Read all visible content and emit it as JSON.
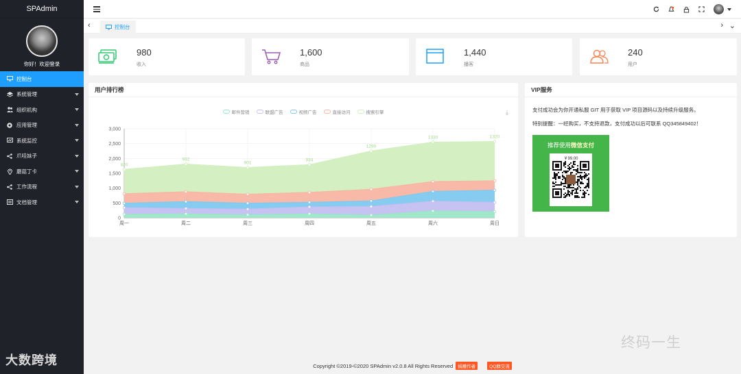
{
  "app": {
    "brand": "SPAdmin",
    "welcome": "你好！欢迎登录"
  },
  "menu": [
    {
      "label": "控制台",
      "icon": "monitor-icon",
      "active": true
    },
    {
      "label": "系统管理",
      "icon": "layers-icon",
      "has_sub": true
    },
    {
      "label": "组织机构",
      "icon": "users-icon",
      "has_sub": true
    },
    {
      "label": "应用管理",
      "icon": "apps-icon",
      "has_sub": true
    },
    {
      "label": "系统监控",
      "icon": "monitor-chart-icon",
      "has_sub": true
    },
    {
      "label": "爪哇妹子",
      "icon": "share-icon",
      "has_sub": true
    },
    {
      "label": "蘑菇丁卡",
      "icon": "location-icon",
      "has_sub": true
    },
    {
      "label": "工作流程",
      "icon": "flow-icon",
      "has_sub": true
    },
    {
      "label": "文档管理",
      "icon": "doc-icon",
      "has_sub": true
    }
  ],
  "topbar": {
    "icons": [
      "refresh-icon",
      "notification-icon",
      "lock-icon",
      "fullscreen-icon"
    ]
  },
  "tabs": [
    {
      "label": "控制台",
      "icon": "monitor-icon"
    }
  ],
  "stats": [
    {
      "value": "980",
      "label": "收入",
      "icon": "money-icon",
      "color": "#2ecc71"
    },
    {
      "value": "1,600",
      "label": "商品",
      "icon": "cart-icon",
      "color": "#9b59b6"
    },
    {
      "value": "1,440",
      "label": "播客",
      "icon": "browser-icon",
      "color": "#1e9fff"
    },
    {
      "value": "240",
      "label": "用户",
      "icon": "users-icon",
      "color": "#ff7e4e"
    }
  ],
  "chart_panel": {
    "title": "用户排行榜"
  },
  "chart_data": {
    "type": "area",
    "stacked": true,
    "categories": [
      "周一",
      "周二",
      "周三",
      "周四",
      "周五",
      "周六",
      "周日"
    ],
    "ylim": [
      0,
      3000
    ],
    "yticks": [
      "0",
      "500",
      "1,000",
      "1,500",
      "2,000",
      "2,500",
      "3,000"
    ],
    "legend_position": "top",
    "series": [
      {
        "name": "邮件营销",
        "color": "#9be6c8",
        "values": [
          120,
          132,
          101,
          134,
          90,
          230,
          210
        ]
      },
      {
        "name": "联盟广告",
        "color": "#c3bff0",
        "values": [
          220,
          182,
          191,
          234,
          290,
          330,
          310
        ]
      },
      {
        "name": "视频广告",
        "color": "#80c8ef",
        "values": [
          150,
          232,
          201,
          154,
          190,
          330,
          410
        ]
      },
      {
        "name": "直接访问",
        "color": "#f8b5a3",
        "values": [
          320,
          332,
          301,
          334,
          390,
          330,
          320
        ]
      },
      {
        "name": "搜索引擎",
        "color": "#d2efc0",
        "values": [
          820,
          932,
          901,
          934,
          1290,
          1330,
          1320
        ]
      }
    ],
    "data_labels": [
      "820",
      "932",
      "901",
      "934",
      "1290",
      "1330",
      "1320"
    ]
  },
  "vip": {
    "title": "VIP服务",
    "text1": "支付成功会为你开通私服 GIT 用于获取 VIP 项目源码以及持续升级服务。",
    "text2": "特别提醒：一经购买，不支持退款，支付成功以后可联系 QQ345849402！",
    "pay_prefix": "推荐使用",
    "pay_brand": "微信支付",
    "price": "￥99.00",
    "color": "#44b549"
  },
  "footer": {
    "copyright": "Copyright ©2019-©2020 SPAdmin v2.0.8 All Rights Reserved",
    "badge1": "捐赠作者",
    "badge2": "QQ群交流"
  },
  "watermarks": {
    "left": "大数跨境",
    "right": "终码一生"
  }
}
